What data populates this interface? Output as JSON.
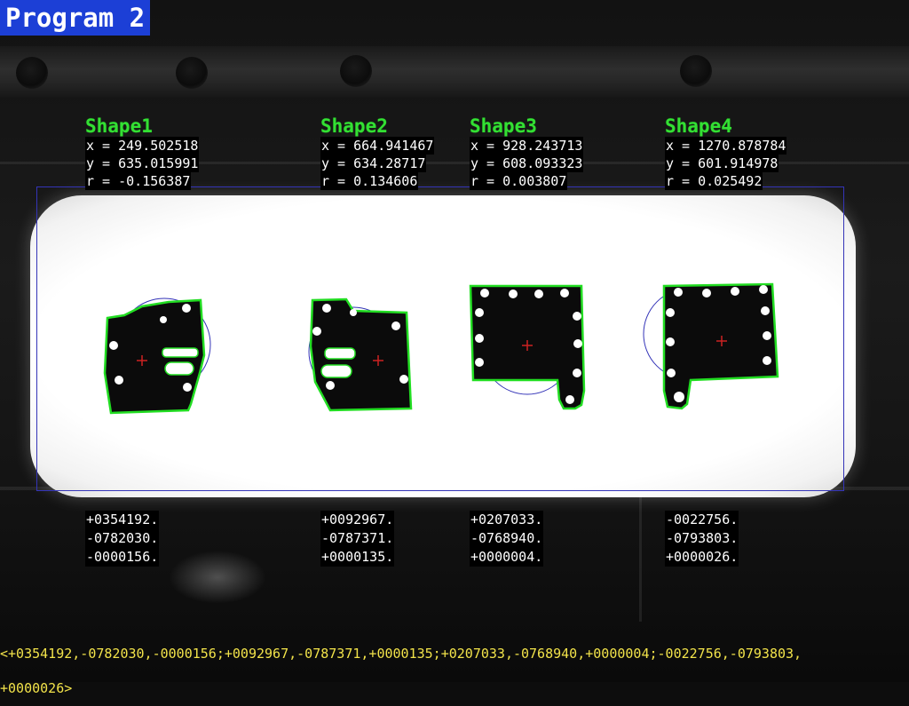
{
  "program_title": "Program 2",
  "shapes": [
    {
      "name": "Shape1",
      "x": "x = 249.502518",
      "y": "y = 635.015991",
      "r": "r = -0.156387",
      "result": [
        "+0354192.",
        "-0782030.",
        "-0000156."
      ]
    },
    {
      "name": "Shape2",
      "x": "x = 664.941467",
      "y": "y = 634.28717",
      "r": "r = 0.134606",
      "result": [
        "+0092967.",
        "-0787371.",
        "+0000135."
      ]
    },
    {
      "name": "Shape3",
      "x": "x = 928.243713",
      "y": "y = 608.093323",
      "r": "r = 0.003807",
      "result": [
        "+0207033.",
        "-0768940.",
        "+0000004."
      ]
    },
    {
      "name": "Shape4",
      "x": "x = 1270.878784",
      "y": "y = 601.914978",
      "r": "r = 0.025492",
      "result": [
        "-0022756.",
        "-0793803.",
        "+0000026."
      ]
    }
  ],
  "serial_output": {
    "line1": "<+0354192,-0782030,-0000156;+0092967,-0787371,+0000135;+0207033,-0768940,+0000004;-0022756,-0793803,",
    "line2": "+0000026>"
  },
  "colors": {
    "title_bg": "#1c3fd6",
    "shape_label": "#33e033",
    "contour": "#22dd22",
    "roi": "#3434b8",
    "center_mark": "#cc2222",
    "serial_text": "#f2e34a"
  }
}
